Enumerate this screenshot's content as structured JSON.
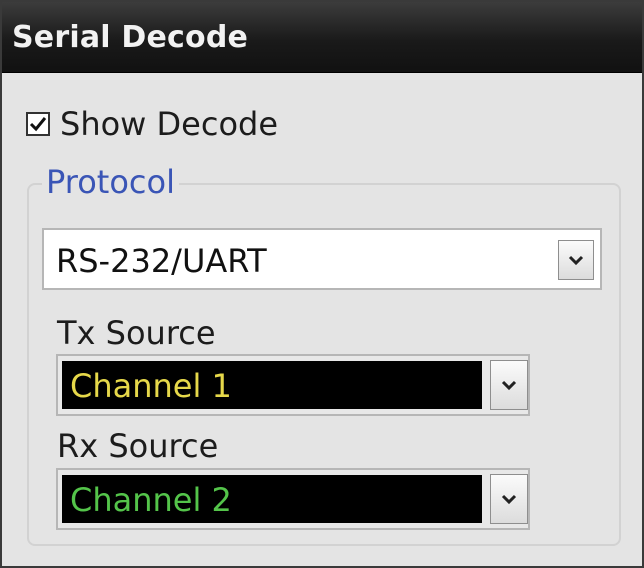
{
  "panel": {
    "title": "Serial Decode"
  },
  "show_decode": {
    "label": "Show Decode",
    "checked": true
  },
  "protocol": {
    "legend": "Protocol",
    "selected": "RS-232/UART"
  },
  "tx_source": {
    "label": "Tx Source",
    "selected": "Channel 1",
    "color": "#e6d84a"
  },
  "rx_source": {
    "label": "Rx Source",
    "selected": "Channel 2",
    "color": "#54c44a"
  },
  "icons": {
    "checkbox": "checkmark-icon",
    "dropdown": "chevron-down-icon"
  }
}
